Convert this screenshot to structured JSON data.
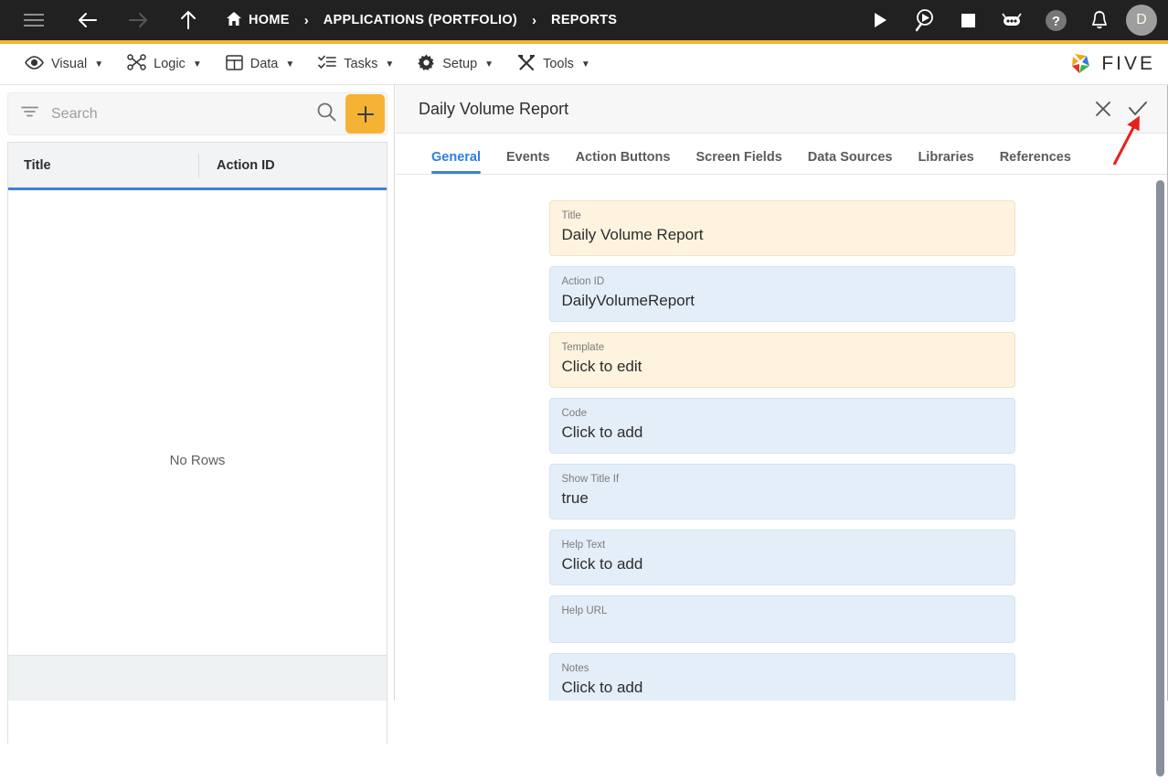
{
  "topbar": {
    "menu_icon": "hamburger-icon",
    "back_icon": "arrow-left-icon",
    "forward_icon": "arrow-right-icon",
    "up_icon": "arrow-up-icon",
    "breadcrumbs": [
      {
        "label": "HOME",
        "icon": "home-icon"
      },
      {
        "label": "APPLICATIONS (PORTFOLIO)",
        "icon": ""
      },
      {
        "label": "REPORTS",
        "icon": ""
      }
    ],
    "separator": "›",
    "actions": [
      {
        "name": "run-icon"
      },
      {
        "name": "debug-icon"
      },
      {
        "name": "stop-icon"
      },
      {
        "name": "chatbot-icon"
      },
      {
        "name": "help-icon"
      },
      {
        "name": "notifications-icon"
      }
    ],
    "avatar_initial": "D",
    "accent_stripe": "#F5B335"
  },
  "menubar": {
    "items": [
      {
        "label": "Visual",
        "icon": "eye-icon"
      },
      {
        "label": "Logic",
        "icon": "nodes-icon"
      },
      {
        "label": "Data",
        "icon": "table-icon"
      },
      {
        "label": "Tasks",
        "icon": "checklist-icon"
      },
      {
        "label": "Setup",
        "icon": "gear-icon"
      },
      {
        "label": "Tools",
        "icon": "tools-icon"
      }
    ],
    "caret": "▼",
    "logo_text": "FIVE"
  },
  "sidebar": {
    "search": {
      "placeholder": "Search",
      "value": ""
    },
    "filter_icon": "filter-icon",
    "search_icon": "search-icon",
    "add_button_label": "+",
    "grid": {
      "columns": [
        "Title",
        "Action ID"
      ],
      "rows": [],
      "empty_message": "No Rows"
    }
  },
  "detail": {
    "title": "Daily Volume Report",
    "close_label": "✕",
    "save_label": "✓",
    "tabs": [
      {
        "label": "General",
        "active": true
      },
      {
        "label": "Events",
        "active": false
      },
      {
        "label": "Action Buttons",
        "active": false
      },
      {
        "label": "Screen Fields",
        "active": false
      },
      {
        "label": "Data Sources",
        "active": false
      },
      {
        "label": "Libraries",
        "active": false
      },
      {
        "label": "References",
        "active": false
      }
    ],
    "fields": [
      {
        "label": "Title",
        "value": "Daily Volume Report",
        "style": "cream"
      },
      {
        "label": "Action ID",
        "value": "DailyVolumeReport",
        "style": "blue"
      },
      {
        "label": "Template",
        "value": "Click to edit",
        "style": "cream"
      },
      {
        "label": "Code",
        "value": "Click to add",
        "style": "blue"
      },
      {
        "label": "Show Title If",
        "value": "true",
        "style": "blue"
      },
      {
        "label": "Help Text",
        "value": "Click to add",
        "style": "blue"
      },
      {
        "label": "Help URL",
        "value": "",
        "style": "blue"
      },
      {
        "label": "Notes",
        "value": "Click to add",
        "style": "blue"
      }
    ]
  },
  "colors": {
    "accent_yellow": "#F5B335",
    "tab_blue": "#3b82d6",
    "topbar_dark": "#212121",
    "field_cream": "#fdf3de",
    "field_blue": "#e4eef9",
    "annotation_red": "#e8201a"
  }
}
